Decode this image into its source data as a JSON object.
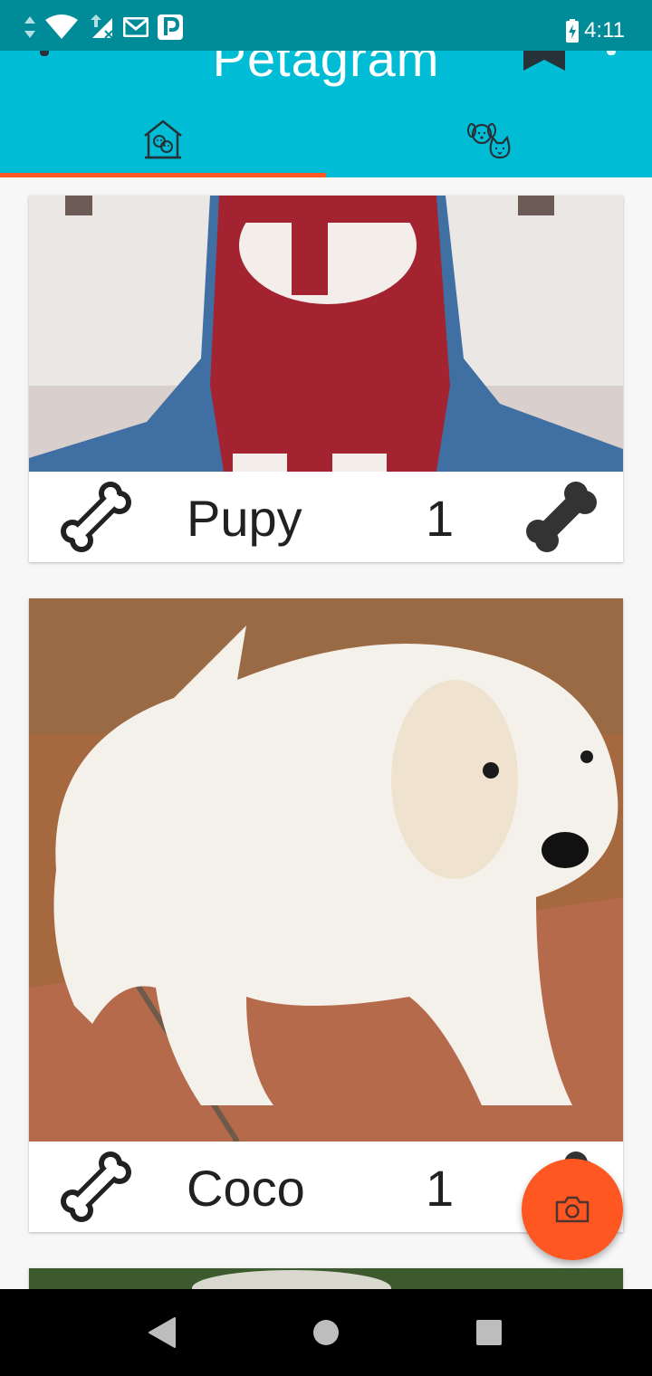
{
  "status_bar": {
    "time": "4:11",
    "icons": [
      "data-arrows-icon",
      "wifi-icon",
      "signal-icon",
      "gmail-icon",
      "parking-icon",
      "battery-charging-icon"
    ]
  },
  "toolbar": {
    "title": "Petagram",
    "actions": [
      "favorites-star-icon",
      "overflow-menu-icon"
    ],
    "background": "#00bcd4",
    "indicator_color": "#ff5722"
  },
  "tabs": [
    {
      "icon": "house-pets-icon",
      "selected": true
    },
    {
      "icon": "dog-cat-faces-icon",
      "selected": false
    }
  ],
  "pets": [
    {
      "name": "Pupy",
      "likes": "1",
      "photo": "puppy-in-red-sweater-photo"
    },
    {
      "name": "Coco",
      "likes": "1",
      "photo": "white-golden-retriever-puppy-photo"
    },
    {
      "name": "",
      "likes": "",
      "photo": "green-outdoor-photo"
    }
  ],
  "fab": {
    "icon": "camera-icon",
    "color": "#ff5722"
  },
  "nav": {
    "buttons": [
      "back-icon",
      "home-icon",
      "recents-icon"
    ]
  }
}
